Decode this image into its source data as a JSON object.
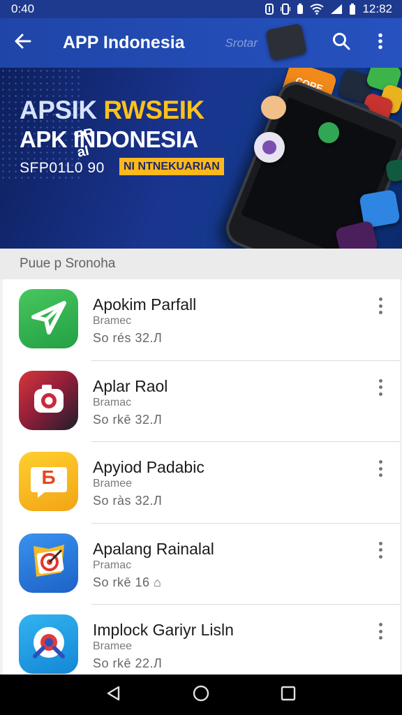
{
  "status_bar": {
    "time_left": "0:40",
    "time_right": "12:82"
  },
  "app_bar": {
    "title": "APP Indonesia",
    "search_hint": "Srotar"
  },
  "banner": {
    "headline_word1": "APSIK",
    "headline_word2": "RWSEIK",
    "headline_line2": "APK INDONESIA",
    "code": "SFP01L0 90",
    "tag": "NI NTNEKUARIAN",
    "phone_logo": "ЯR aI",
    "tile_text": "CORE"
  },
  "section": {
    "title": "Puue p Sronoha"
  },
  "apps": [
    {
      "name": "Apokim Parfall",
      "developer": "Bramec",
      "meta": "So rés 32.Л",
      "icon": "paper-plane-icon",
      "color": "#2fb24b"
    },
    {
      "name": "Aplar Raol",
      "developer": "Bramac",
      "meta": "So rkē 32.Л",
      "icon": "camera-icon",
      "color": "#b2223a"
    },
    {
      "name": "Apyiod Padabic",
      "developer": "Bramee",
      "meta": "So ràs 32.Л",
      "icon": "chat-bubble-icon",
      "color": "#f5a91a",
      "glyph": "Б"
    },
    {
      "name": "Apalang Rainalal",
      "developer": "Pramac",
      "meta": "So rkē 16 ⌂",
      "icon": "target-icon",
      "color": "#2a79d8"
    },
    {
      "name": "Implock Gariyr Lisln",
      "developer": "Bramee",
      "meta": "So rkē 22.Л",
      "icon": "crosshair-icon",
      "color": "#1c9be0"
    }
  ]
}
